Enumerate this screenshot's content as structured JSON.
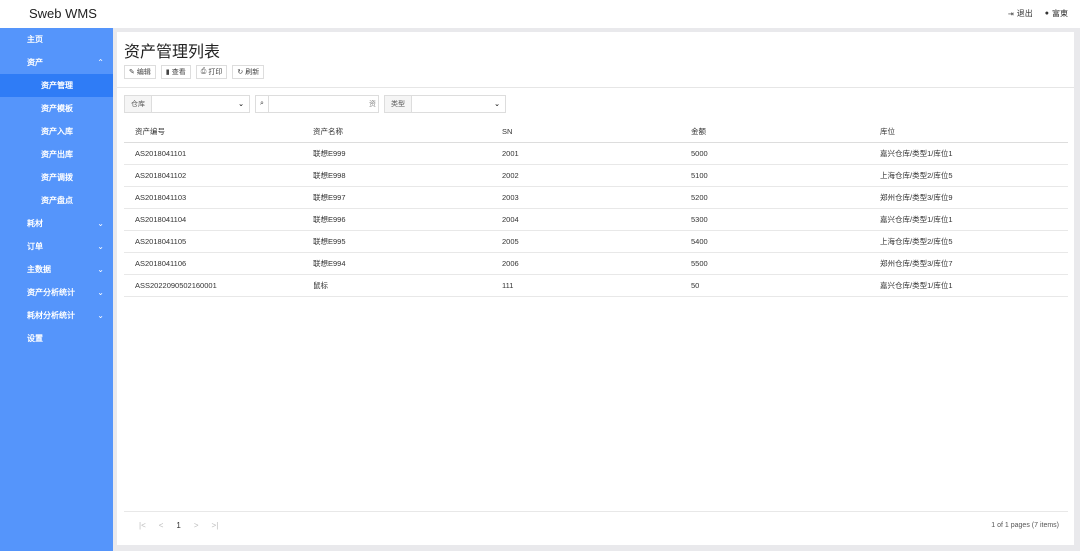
{
  "app": {
    "title": "Sweb WMS"
  },
  "top_actions": [
    {
      "icon": "sign-out-icon",
      "glyph": "⇥",
      "label": "退出"
    },
    {
      "icon": "user-icon",
      "glyph": "●",
      "label": "富東"
    }
  ],
  "sidebar": {
    "items": [
      {
        "label": "主页",
        "chevron": "",
        "children": []
      },
      {
        "label": "资产",
        "chevron": "⌃",
        "children": [
          {
            "label": "资产管理",
            "active": true
          },
          {
            "label": "资产模板",
            "active": false
          },
          {
            "label": "资产入库",
            "active": false
          },
          {
            "label": "资产出库",
            "active": false
          },
          {
            "label": "资产调拨",
            "active": false
          },
          {
            "label": "资产盘点",
            "active": false
          }
        ]
      },
      {
        "label": "耗材",
        "chevron": "⌄",
        "children": []
      },
      {
        "label": "订单",
        "chevron": "⌄",
        "children": []
      },
      {
        "label": "主数据",
        "chevron": "⌄",
        "children": []
      },
      {
        "label": "资产分析统计",
        "chevron": "⌄",
        "children": []
      },
      {
        "label": "耗材分析统计",
        "chevron": "⌄",
        "children": []
      },
      {
        "label": "设置",
        "chevron": "",
        "children": []
      }
    ]
  },
  "main": {
    "title": "资产管理列表",
    "toolbar": [
      {
        "name": "edit",
        "icon": "edit-icon",
        "glyph": "✎",
        "label": "编辑"
      },
      {
        "name": "view",
        "icon": "bookmark-icon",
        "glyph": "▮",
        "label": "查看"
      },
      {
        "name": "print",
        "icon": "print-icon",
        "glyph": "⎙",
        "label": "打印"
      },
      {
        "name": "refresh",
        "icon": "refresh-icon",
        "glyph": "↻",
        "label": "刷新"
      }
    ],
    "filters": {
      "warehouse_label": "仓库",
      "warehouse_value": "",
      "search_value": "资",
      "type_label": "类型",
      "type_value": ""
    },
    "table": {
      "columns": [
        "资产编号",
        "资产名称",
        "SN",
        "金额",
        "库位"
      ],
      "rows": [
        [
          "AS2018041101",
          "联想E999",
          "2001",
          "5000",
          "嘉兴仓库/类型1/库位1"
        ],
        [
          "AS2018041102",
          "联想E998",
          "2002",
          "5100",
          "上海仓库/类型2/库位5"
        ],
        [
          "AS2018041103",
          "联想E997",
          "2003",
          "5200",
          "郑州仓库/类型3/库位9"
        ],
        [
          "AS2018041104",
          "联想E996",
          "2004",
          "5300",
          "嘉兴仓库/类型1/库位1"
        ],
        [
          "AS2018041105",
          "联想E995",
          "2005",
          "5400",
          "上海仓库/类型2/库位5"
        ],
        [
          "AS2018041106",
          "联想E994",
          "2006",
          "5500",
          "郑州仓库/类型3/库位7"
        ],
        [
          "ASS2022090502160001",
          "鼠标",
          "111",
          "50",
          "嘉兴仓库/类型1/库位1"
        ]
      ]
    },
    "pagination": {
      "first": "|<",
      "prev": "<",
      "current": "1",
      "next": ">",
      "last": ">|",
      "info": "1 of 1 pages (7 items)"
    }
  },
  "colors": {
    "sidebar": "#5595fb",
    "sidebar_active": "#2f7cf6"
  }
}
